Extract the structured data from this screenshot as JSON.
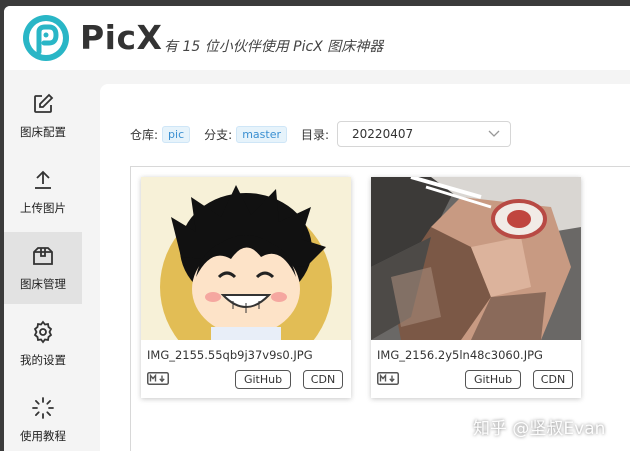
{
  "header": {
    "title": "PicX",
    "subtitle": "有 15 位小伙伴使用 PicX 图床神器"
  },
  "sidebar": {
    "items": [
      {
        "label": "图床配置",
        "icon": "edit-icon",
        "active": false
      },
      {
        "label": "上传图片",
        "icon": "upload-icon",
        "active": false
      },
      {
        "label": "图床管理",
        "icon": "box-icon",
        "active": true
      },
      {
        "label": "我的设置",
        "icon": "gear-icon",
        "active": false
      },
      {
        "label": "使用教程",
        "icon": "loading-icon",
        "active": false
      }
    ]
  },
  "toolbar": {
    "repo_label": "仓库:",
    "repo_value": "pic",
    "branch_label": "分支:",
    "branch_value": "master",
    "dir_label": "目录:",
    "dir_value": "20220407"
  },
  "images": [
    {
      "filename": "IMG_2155.55qb9j37v9s0.JPG",
      "github_label": "GitHub",
      "cdn_label": "CDN",
      "md_icon": "markdown-icon"
    },
    {
      "filename": "IMG_2156.2y5ln48c3060.JPG",
      "github_label": "GitHub",
      "cdn_label": "CDN",
      "md_icon": "markdown-icon"
    }
  ],
  "watermark": "知乎 @坚叔Evan",
  "colors": {
    "accent": "#3a8fd1",
    "tag_bg": "#e6f3fb",
    "logo_teal": "#29b6c6"
  }
}
